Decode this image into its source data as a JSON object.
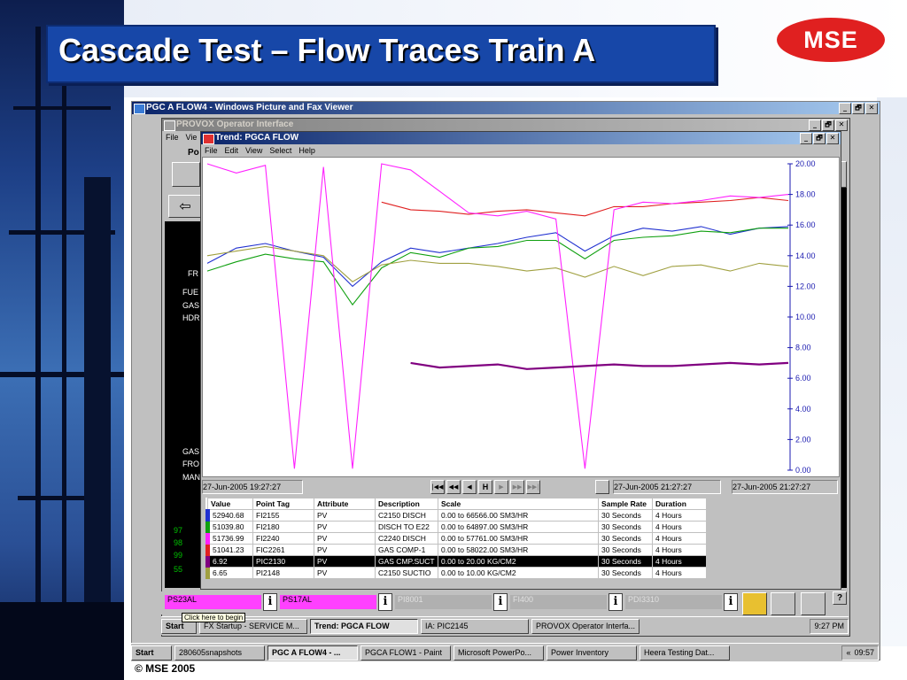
{
  "slide": {
    "title": "Cascade Test – Flow Traces Train A",
    "logo": "MSE",
    "copyright": "© MSE 2005"
  },
  "viewer": {
    "title": "PGC A FLOW4 - Windows Picture and Fax Viewer",
    "controls": [
      "_",
      "🗗",
      "✕"
    ]
  },
  "provox": {
    "title": "PROVOX Operator Interface",
    "menu": [
      "File",
      "Vie"
    ],
    "tab_fragment": "Po",
    "left_labels": [
      "FR",
      "FUE",
      "GAS",
      "HDR"
    ],
    "left_labels_low": [
      "GAS",
      "FRO",
      "MAN"
    ],
    "left_numbers": [
      "97",
      "98",
      "99",
      "55"
    ],
    "point_tags": [
      "PS23AL",
      "PS17AL",
      "PI8001",
      "FI400",
      "PDI3310"
    ],
    "info_glyph": "i",
    "help_glyph": "?",
    "tooltip": "Click here to begin"
  },
  "trend": {
    "title": "Trend: PGCA FLOW",
    "menu": [
      "File",
      "Edit",
      "View",
      "Select",
      "Help"
    ],
    "time_start": "27-Jun-2005 19:27:27",
    "time_cursor": "27-Jun-2005 21:27:27",
    "time_end": "27-Jun-2005 21:27:27",
    "nav_buttons": [
      "|◀◀",
      "◀◀",
      "◀",
      "H",
      "▶",
      "▶▶",
      "▶▶|"
    ],
    "table_headers": [
      "Value",
      "Point Tag",
      "Attribute",
      "Description",
      "Scale",
      "Sample Rate",
      "Duration"
    ],
    "rows": [
      {
        "swatch": "#2030d0",
        "value": "52940.68",
        "tag": "FI2155",
        "attr": "PV",
        "desc": "C2150 DISCH",
        "scale": "0.00 to 66566.00 SM3/HR",
        "rate": "30 Seconds",
        "dur": "4 Hours"
      },
      {
        "swatch": "#10a010",
        "value": "51039.80",
        "tag": "FI2180",
        "attr": "PV",
        "desc": "DISCH TO E22",
        "scale": "0.00 to 64897.00 SM3/HR",
        "rate": "30 Seconds",
        "dur": "4 Hours"
      },
      {
        "swatch": "#ff20ff",
        "value": "51736.99",
        "tag": "FI2240",
        "attr": "PV",
        "desc": "C2240 DISCH",
        "scale": "0.00 to 57761.00 SM3/HR",
        "rate": "30 Seconds",
        "dur": "4 Hours"
      },
      {
        "swatch": "#e02020",
        "value": "51041.23",
        "tag": "FIC2261",
        "attr": "PV",
        "desc": "GAS COMP-1",
        "scale": "0.00 to 58022.00 SM3/HR",
        "rate": "30 Seconds",
        "dur": "4 Hours"
      },
      {
        "swatch": "#800080",
        "value": "6.92",
        "tag": "PIC2130",
        "attr": "PV",
        "desc": "GAS CMP.SUCT",
        "scale": "0.00 to 20.00 KG/CM2",
        "rate": "30 Seconds",
        "dur": "4 Hours"
      },
      {
        "swatch": "#a0a040",
        "value": "6.65",
        "tag": "PI2148",
        "attr": "PV",
        "desc": "C2150 SUCTIO",
        "scale": "0.00 to 10.00 KG/CM2",
        "rate": "30 Seconds",
        "dur": "4 Hours"
      }
    ]
  },
  "chart_data": {
    "type": "line",
    "ylim": [
      0,
      20
    ],
    "y_ticks": [
      "0.00",
      "2.00",
      "4.00",
      "6.00",
      "8.00",
      "10.00",
      "12.00",
      "14.00",
      "16.00",
      "18.00",
      "20.00"
    ],
    "x": [
      0,
      5,
      10,
      15,
      20,
      25,
      30,
      35,
      40,
      45,
      50,
      55,
      60,
      65,
      70,
      75,
      80,
      85,
      90,
      95,
      100
    ],
    "series": [
      {
        "color": "#2030d0",
        "values": [
          13.5,
          14.5,
          14.8,
          14.3,
          13.9,
          12.0,
          13.6,
          14.5,
          14.2,
          14.5,
          14.8,
          15.2,
          15.5,
          14.3,
          15.3,
          15.8,
          15.6,
          15.9,
          15.4,
          15.8,
          15.9
        ]
      },
      {
        "color": "#10a010",
        "values": [
          13.0,
          13.6,
          14.1,
          13.8,
          13.6,
          10.8,
          13.2,
          14.2,
          13.9,
          14.5,
          14.6,
          15.0,
          15.0,
          13.8,
          15.0,
          15.2,
          15.3,
          15.6,
          15.5,
          15.8,
          15.8
        ]
      },
      {
        "color": "#a0a040",
        "values": [
          14.0,
          14.3,
          14.6,
          14.3,
          14.0,
          12.3,
          13.4,
          13.7,
          13.5,
          13.5,
          13.3,
          13.0,
          13.2,
          12.6,
          13.3,
          12.7,
          13.3,
          13.4,
          13.0,
          13.5,
          13.3
        ]
      },
      {
        "color": "#e02020",
        "values": [
          null,
          null,
          null,
          null,
          null,
          null,
          17.5,
          17.0,
          16.9,
          16.7,
          16.9,
          17.0,
          16.8,
          16.6,
          17.2,
          17.2,
          17.4,
          17.5,
          17.6,
          17.8,
          17.6
        ]
      },
      {
        "color": "#ff20ff",
        "values": [
          20.0,
          19.4,
          19.9,
          0.1,
          19.8,
          0.1,
          20.0,
          19.6,
          18.2,
          16.8,
          16.6,
          16.9,
          16.4,
          0.1,
          17.0,
          17.5,
          17.4,
          17.6,
          17.9,
          17.8,
          18.0
        ]
      },
      {
        "color": "#800080",
        "values": [
          null,
          null,
          null,
          null,
          null,
          null,
          null,
          7.0,
          6.7,
          6.8,
          6.9,
          6.6,
          6.7,
          6.8,
          6.9,
          6.8,
          6.8,
          6.9,
          7.0,
          6.9,
          7.0
        ]
      }
    ]
  },
  "taskbar_inner": {
    "start": "Start",
    "tasks": [
      "FX Startup - SERVICE M...",
      "Trend: PGCA FLOW",
      "IA: PIC2145",
      "PROVOX Operator Interfa..."
    ],
    "clock": "9:27 PM"
  },
  "taskbar_outer": {
    "start": "Start",
    "tasks": [
      "280605snapshots",
      "PGC A FLOW4 - ...",
      "PGCA FLOW1 - Paint",
      "Microsoft PowerPo...",
      "Power Inventory",
      "Heera Testing Dat..."
    ],
    "tray_arrows": "«",
    "clock": "09:57"
  }
}
